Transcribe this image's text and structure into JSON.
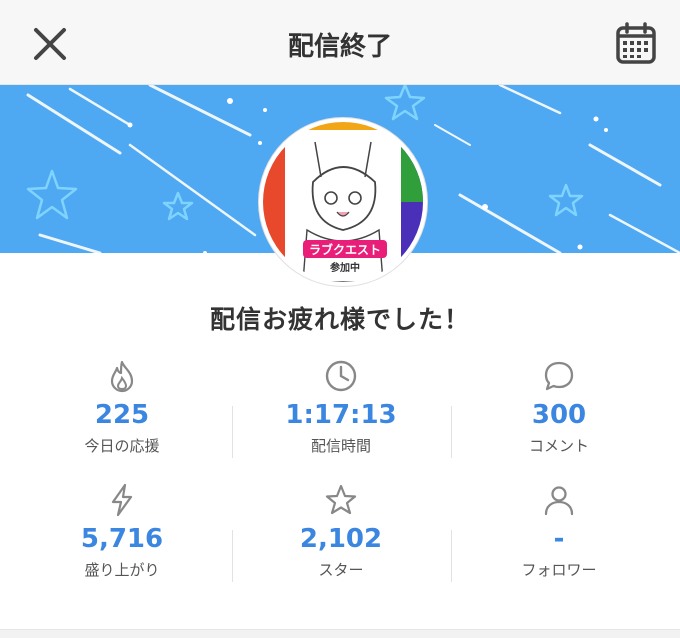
{
  "header": {
    "title": "配信終了",
    "close_icon": "close-icon",
    "calendar_icon": "calendar-icon"
  },
  "banner": {
    "color": "#4fa8f2"
  },
  "avatar": {
    "badge_text": "ラブクエスト",
    "badge_sub": "参加中"
  },
  "greeting": "配信お疲れ様でした！",
  "stats": [
    {
      "icon": "flame-icon",
      "value": "225",
      "label": "今日の応援"
    },
    {
      "icon": "clock-icon",
      "value": "1:17:13",
      "label": "配信時間"
    },
    {
      "icon": "comment-icon",
      "value": "300",
      "label": "コメント"
    },
    {
      "icon": "lightning-icon",
      "value": "5,716",
      "label": "盛り上がり"
    },
    {
      "icon": "star-icon",
      "value": "2,102",
      "label": "スター"
    },
    {
      "icon": "person-icon",
      "value": "-",
      "label": "フォロワー"
    }
  ],
  "colors": {
    "accent": "#3a86e0",
    "icon": "#888888"
  }
}
